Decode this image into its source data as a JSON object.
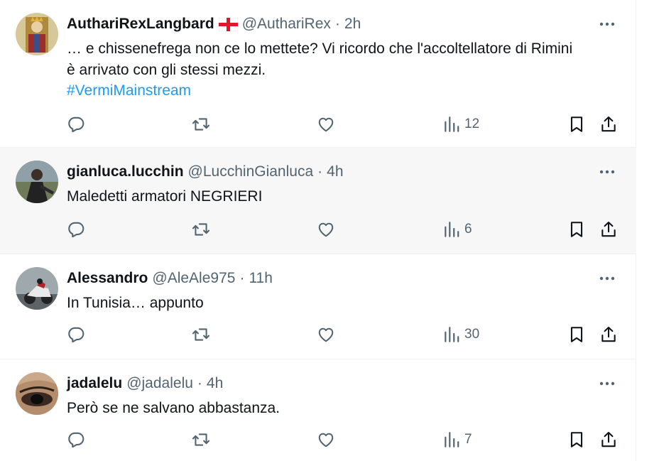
{
  "replies": [
    {
      "display_name": "AuthariRexLangbard",
      "flag_icon": "england-flag-icon",
      "handle": "@AuthariRex",
      "separator": "·",
      "time": "2h",
      "text_lines": [
        "… e chissenefrega non ce lo mettete? Vi ricordo che l'accoltellatore di Rimini",
        "è arrivato con gli stessi mezzi."
      ],
      "hashtag": "#VermiMainstream",
      "views": "12"
    },
    {
      "display_name": "gianluca.lucchin",
      "handle": "@LucchinGianluca",
      "separator": "·",
      "time": "4h",
      "text_lines": [
        "Maledetti armatori NEGRIERI"
      ],
      "views": "6"
    },
    {
      "display_name": "Alessandro",
      "handle": "@AleAle975",
      "separator": "·",
      "time": "11h",
      "text_lines": [
        "In Tunisia… appunto"
      ],
      "views": "30"
    },
    {
      "display_name": "jadalelu",
      "handle": "@jadalelu",
      "separator": "·",
      "time": "4h",
      "text_lines": [
        "Però se ne salvano abbastanza."
      ],
      "views": "7"
    }
  ],
  "colors": {
    "text": "#0f1419",
    "secondary": "#536471",
    "link": "#1d9bf0",
    "hover_bg": "#f7f7f7",
    "divider": "#eff3f4"
  },
  "icons": [
    "reply-icon",
    "retweet-icon",
    "like-icon",
    "views-icon",
    "bookmark-icon",
    "share-icon",
    "more-icon"
  ]
}
